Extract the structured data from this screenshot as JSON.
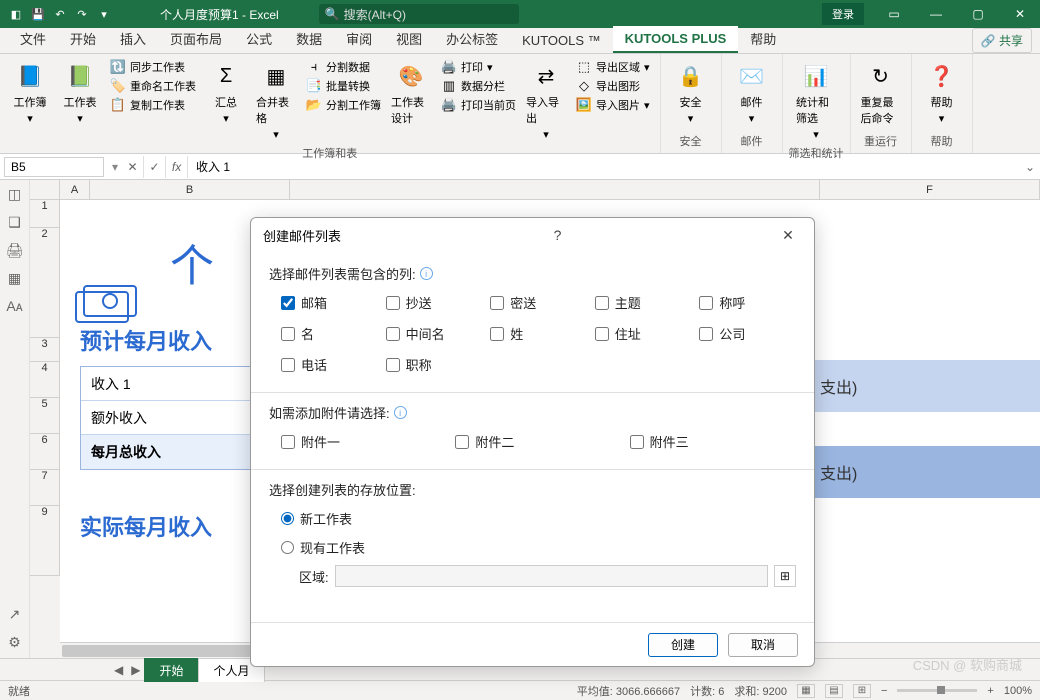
{
  "titlebar": {
    "title": "个人月度预算1  -  Excel",
    "search_placeholder": "搜索(Alt+Q)",
    "login": "登录"
  },
  "tabs": [
    "文件",
    "开始",
    "插入",
    "页面布局",
    "公式",
    "数据",
    "审阅",
    "视图",
    "办公标签",
    "KUTOOLS ™",
    "KUTOOLS PLUS",
    "帮助"
  ],
  "active_tab": 10,
  "share": "共享",
  "ribbon": {
    "group1_label": "工作簿和表",
    "btn_workbook": "工作簿",
    "btn_sheet": "工作表",
    "btn_sync": "同步工作表",
    "btn_rename": "重命名工作表",
    "btn_copy": "复制工作表",
    "btn_sum": "汇总",
    "btn_merge": "合并表格",
    "btn_split_data": "分割数据",
    "btn_batch": "批量转换",
    "btn_split_wb": "分割工作簿",
    "btn_design": "工作表设计",
    "btn_print": "打印",
    "btn_columns": "数据分栏",
    "btn_print_page": "打印当前页",
    "btn_import": "导入导出",
    "btn_export_area": "导出区域",
    "btn_export_shape": "导出图形",
    "btn_import_img": "导入图片",
    "group2_label": "安全",
    "btn_security": "安全",
    "group3_label": "邮件",
    "btn_mail": "邮件",
    "group4_label": "筛选和统计",
    "btn_stats": "统计和筛选",
    "group5_label": "重运行",
    "btn_redo": "重复最后命令",
    "group6_label": "帮助",
    "btn_help": "帮助"
  },
  "formula": {
    "cell": "B5",
    "value": "收入 1"
  },
  "columns": [
    "A",
    "B",
    "F"
  ],
  "rows": [
    1,
    2,
    3,
    4,
    5,
    6,
    7,
    9
  ],
  "sheet": {
    "big_title": "个",
    "section1": "预计每月收入",
    "row_income1": "收入 1",
    "row_extra": "额外收入",
    "row_total": "每月总收入",
    "section2": "实际每月收入",
    "bar1": "支出)",
    "bar2": "支出)"
  },
  "sheet_tabs": {
    "active": "开始",
    "other": "个人月"
  },
  "status": {
    "ready": "就绪",
    "avg_label": "平均值:",
    "avg": "3066.666667",
    "count_label": "计数:",
    "count": "6",
    "sum_label": "求和:",
    "sum": "9200",
    "zoom": "100%"
  },
  "watermark": "CSDN @ 软购商城",
  "dialog": {
    "title": "创建邮件列表",
    "section_columns": "选择邮件列表需包含的列:",
    "cb_email": "邮箱",
    "cb_cc": "抄送",
    "cb_bcc": "密送",
    "cb_subject": "主题",
    "cb_salutation": "称呼",
    "cb_fname": "名",
    "cb_mname": "中间名",
    "cb_lname": "姓",
    "cb_address": "住址",
    "cb_company": "公司",
    "cb_phone": "电话",
    "cb_title": "职称",
    "section_attach": "如需添加附件请选择:",
    "cb_att1": "附件一",
    "cb_att2": "附件二",
    "cb_att3": "附件三",
    "section_location": "选择创建列表的存放位置:",
    "rb_new": "新工作表",
    "rb_exist": "现有工作表",
    "region_label": "区域:",
    "btn_create": "创建",
    "btn_cancel": "取消"
  }
}
